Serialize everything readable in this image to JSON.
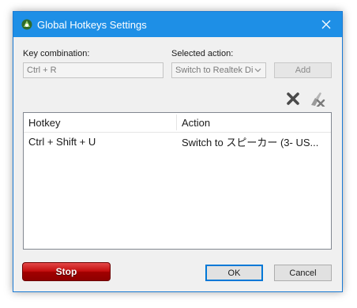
{
  "window": {
    "title": "Global Hotkeys Settings"
  },
  "form": {
    "key_label": "Key combination:",
    "key_value": "Ctrl + R",
    "action_label": "Selected action:",
    "action_value": "Switch to Realtek Di",
    "add_label": "Add"
  },
  "list": {
    "columns": [
      "Hotkey",
      "Action"
    ],
    "rows": [
      {
        "hotkey": "Ctrl + Shift + U",
        "action": "Switch to スピーカー (3- US..."
      }
    ]
  },
  "footer": {
    "stop_label": "Stop",
    "ok_label": "OK",
    "cancel_label": "Cancel"
  },
  "colors": {
    "titlebar": "#1e8fe6",
    "stop": "#c30d0d",
    "focus_border": "#0078d7"
  },
  "icons": [
    "app-icon",
    "close-icon",
    "delete-icon",
    "clear-icon",
    "chevron-down-icon"
  ]
}
